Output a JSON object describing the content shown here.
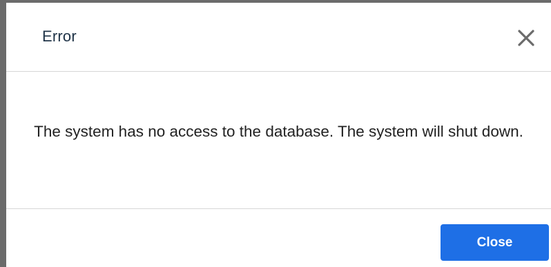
{
  "dialog": {
    "title": "Error",
    "close_icon": "close-icon",
    "message": "The system has no access to the database. The system will shut down.",
    "buttons": {
      "close_label": "Close"
    }
  },
  "colors": {
    "title_text": "#1f3347",
    "message_text": "#222222",
    "primary_button": "#1e6fe6",
    "divider": "#d6d6d6",
    "close_icon": "#6b6b6b"
  }
}
